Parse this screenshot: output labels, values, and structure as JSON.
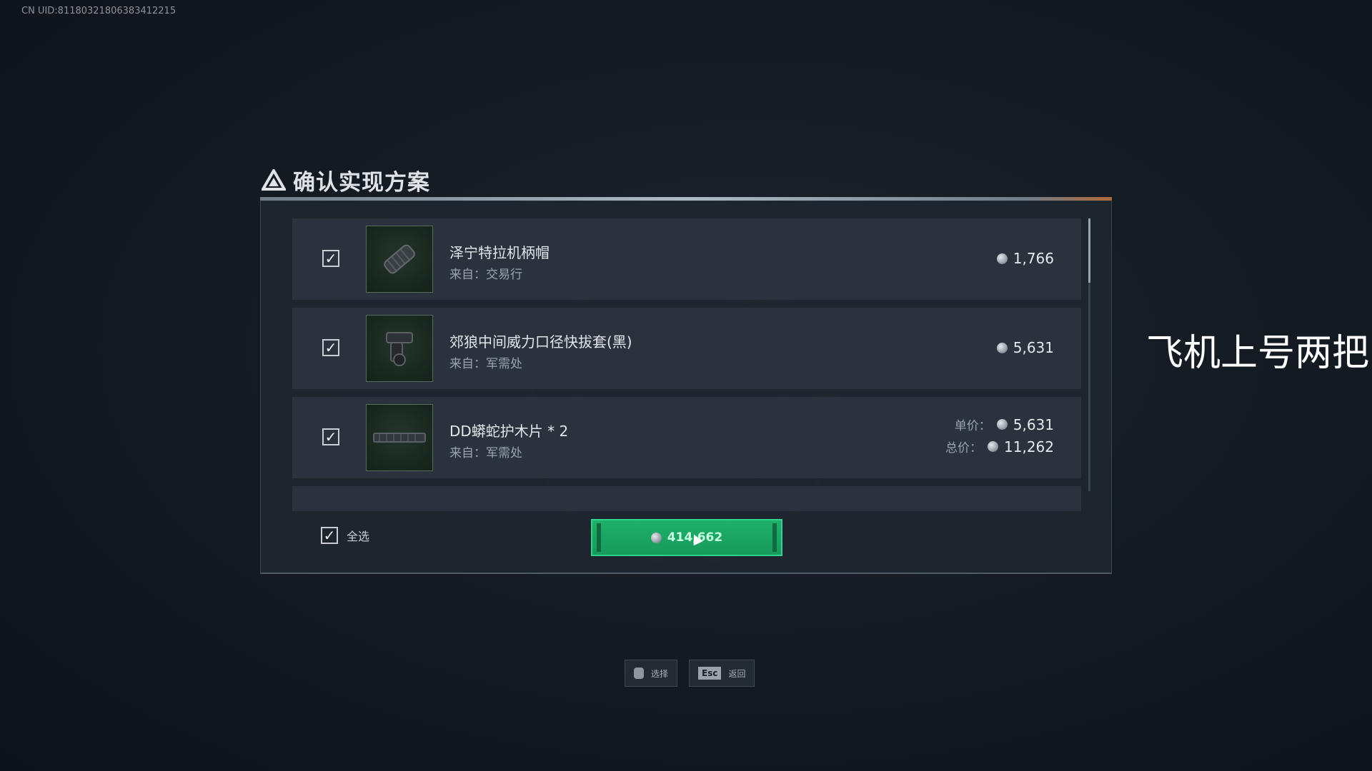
{
  "uid_text": "CN UID:8118032180638​3412215",
  "dialog": {
    "title": "确认实现方案",
    "items": [
      {
        "name": "泽宁特拉机柄帽",
        "source": "来自：交易行",
        "price": "1,766",
        "icon": "cylinder-grip-icon"
      },
      {
        "name": "郊狼中间威力口径快拔套(黑)",
        "source": "来自：军需处",
        "price": "5,631",
        "icon": "mount-icon"
      },
      {
        "name": "DD蟒蛇护木片 * 2",
        "source": "来自：军需处",
        "unit_label": "单价：",
        "unit_price": "5,631",
        "total_label": "总价：",
        "total_price": "11,262",
        "icon": "rail-cover-icon"
      }
    ],
    "select_all_label": "全选",
    "buy_amount": "414,662"
  },
  "hints": {
    "select_label": "选择",
    "back_key": "Esc",
    "back_label": "返回"
  },
  "overlay_caption": "飞机上号两把"
}
